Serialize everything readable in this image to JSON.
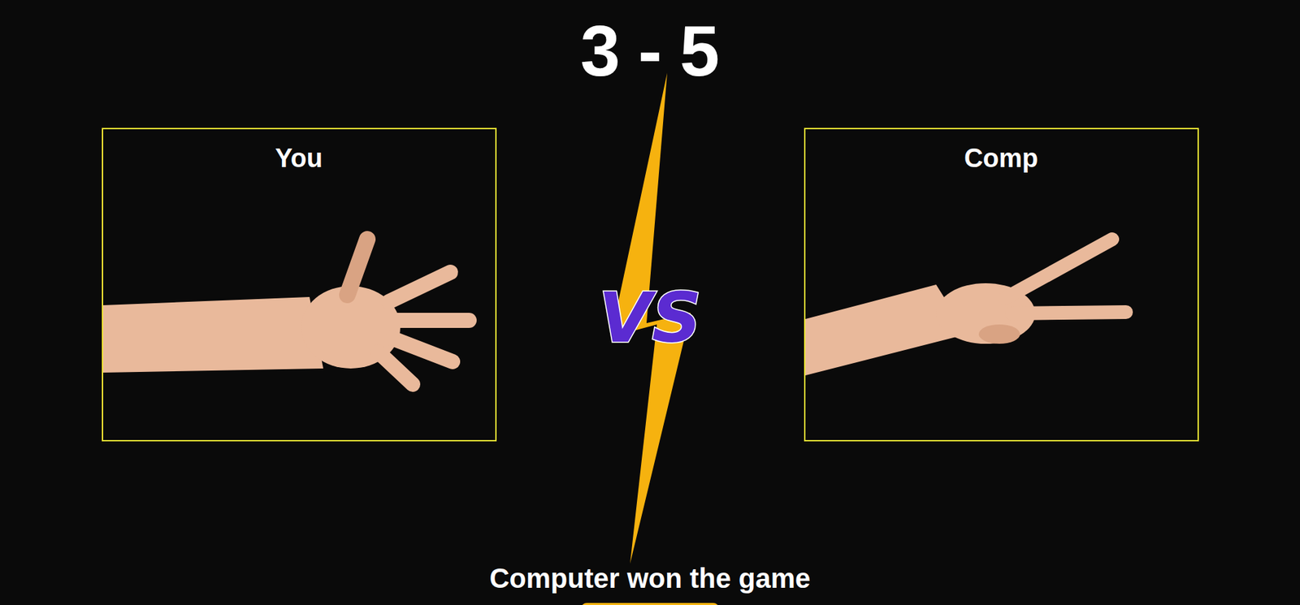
{
  "score": {
    "user": "3",
    "separator": "-",
    "computer": "5"
  },
  "players": [
    {
      "label": "You",
      "kind": "paper"
    },
    {
      "label": "Comp",
      "kind": "scissors"
    }
  ],
  "versus": "VS",
  "message": "Computer won the game"
}
